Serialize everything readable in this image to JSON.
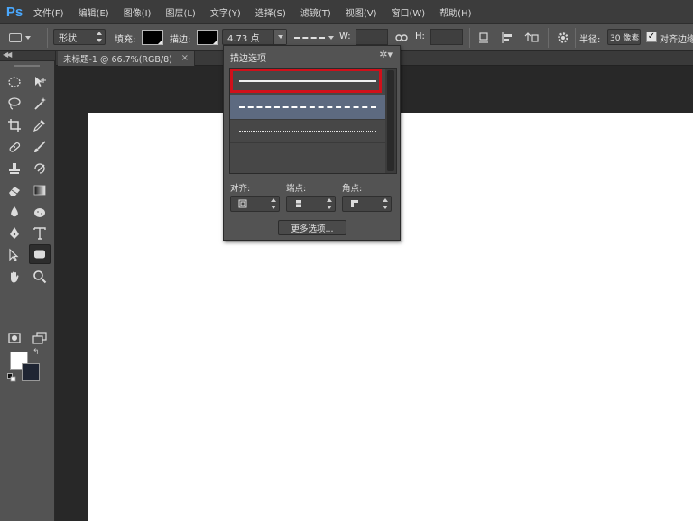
{
  "app": {
    "logo_text": "Ps"
  },
  "menu": [
    "文件(F)",
    "编辑(E)",
    "图像(I)",
    "图层(L)",
    "文字(Y)",
    "选择(S)",
    "滤镜(T)",
    "视图(V)",
    "窗口(W)",
    "帮助(H)"
  ],
  "options_bar": {
    "mode_value": "形状",
    "fill_label": "填充:",
    "fill_color": "#000000",
    "stroke_label": "描边:",
    "stroke_color": "#000000",
    "stroke_width": "4.73 点",
    "width_label": "W:",
    "height_label": "H:",
    "radius_label": "半径:",
    "radius_value": "30 像素",
    "align_edges_label": "对齐边缘"
  },
  "document": {
    "tab_title": "未标题-1 @ 66.7%(RGB/8)",
    "tab_close": "×"
  },
  "stroke_popup": {
    "title": "描边选项",
    "styles": [
      "solid",
      "dashed",
      "dotted"
    ],
    "selected_style": "solid",
    "align_label": "对齐:",
    "caps_label": "端点:",
    "corners_label": "角点:",
    "more_options_label": "更多选项..."
  },
  "colors": {
    "foreground": "#ffffff",
    "background": "#1f2533",
    "highlight": "#d0101a",
    "accent": "#4aa9ff"
  }
}
